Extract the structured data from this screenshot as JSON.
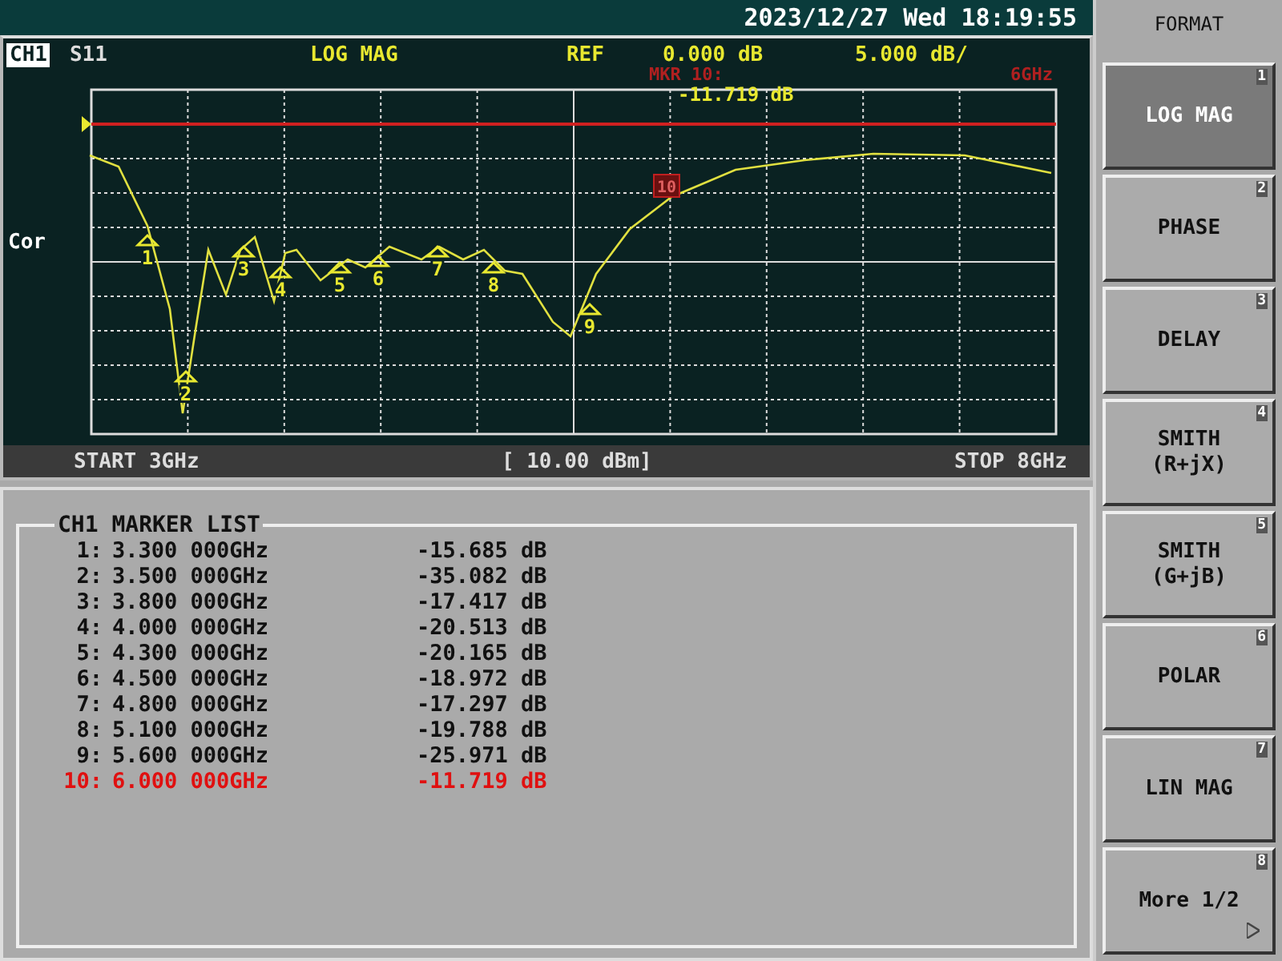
{
  "status_bar": {
    "datetime": "2023/12/27 Wed 18:19:55"
  },
  "trace_header": {
    "channel": "CH1",
    "parameter": "S11",
    "format": "LOG MAG",
    "ref_label": "REF",
    "ref_value": "0.000 dB",
    "scale": "5.000 dB/"
  },
  "marker_readout": {
    "label": "MKR 10:",
    "frequency": "6GHz",
    "value": "-11.719 dB"
  },
  "side_label": "Cor",
  "sweep": {
    "start": "START 3GHz",
    "power": "[ 10.00 dBm]",
    "stop": "STOP 8GHz"
  },
  "marker_list": {
    "title": "CH1 MARKER LIST",
    "rows": [
      {
        "index": "1:",
        "label": "1",
        "frequency": "3.300 000GHz",
        "value": "-15.685 dB",
        "selected": false
      },
      {
        "index": "2:",
        "label": "2",
        "frequency": "3.500 000GHz",
        "value": "-35.082 dB",
        "selected": false
      },
      {
        "index": "3:",
        "label": "3",
        "frequency": "3.800 000GHz",
        "value": "-17.417 dB",
        "selected": false
      },
      {
        "index": "4:",
        "label": "4",
        "frequency": "4.000 000GHz",
        "value": "-20.513 dB",
        "selected": false
      },
      {
        "index": "5:",
        "label": "5",
        "frequency": "4.300 000GHz",
        "value": "-20.165 dB",
        "selected": false
      },
      {
        "index": "6:",
        "label": "6",
        "frequency": "4.500 000GHz",
        "value": "-18.972 dB",
        "selected": false
      },
      {
        "index": "7:",
        "label": "7",
        "frequency": "4.800 000GHz",
        "value": "-17.297 dB",
        "selected": false
      },
      {
        "index": "8:",
        "label": "8",
        "frequency": "5.100 000GHz",
        "value": "-19.788 dB",
        "selected": false
      },
      {
        "index": "9:",
        "label": "9",
        "frequency": "5.600 000GHz",
        "value": "-25.971 dB",
        "selected": false
      },
      {
        "index": "10:",
        "label": "10",
        "frequency": "6.000 000GHz",
        "value": "-11.719 dB",
        "selected": true
      }
    ]
  },
  "softkeys": {
    "title": "FORMAT",
    "items": [
      {
        "label": "LOG MAG",
        "number": "1",
        "selected": true
      },
      {
        "label": "PHASE",
        "number": "2",
        "selected": false
      },
      {
        "label": "DELAY",
        "number": "3",
        "selected": false
      },
      {
        "label": "SMITH\n(R+jX)",
        "number": "4",
        "selected": false
      },
      {
        "label": "SMITH\n(G+jB)",
        "number": "5",
        "selected": false
      },
      {
        "label": "POLAR",
        "number": "6",
        "selected": false
      },
      {
        "label": "LIN MAG",
        "number": "7",
        "selected": false
      },
      {
        "label": "More 1/2",
        "number": "8",
        "selected": false,
        "submenu": true
      }
    ]
  }
}
